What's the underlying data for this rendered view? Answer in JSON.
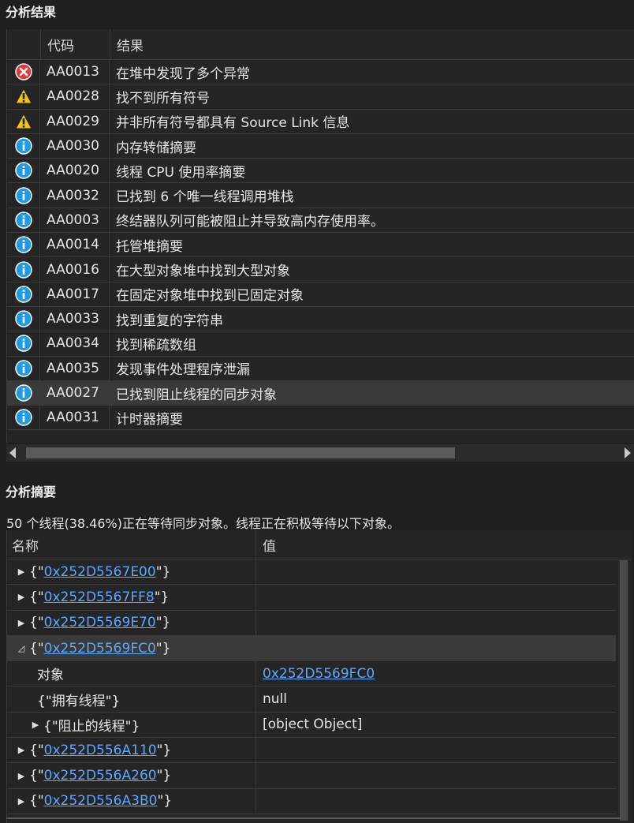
{
  "results_section": {
    "title": "分析结果",
    "headers": {
      "code": "代码",
      "result": "结果"
    },
    "rows": [
      {
        "icon": "error-icon",
        "code": "AA0013",
        "result": "在堆中发现了多个异常"
      },
      {
        "icon": "warning-icon",
        "code": "AA0028",
        "result": "找不到所有符号"
      },
      {
        "icon": "warning-icon",
        "code": "AA0029",
        "result": "并非所有符号都具有 Source Link 信息"
      },
      {
        "icon": "info-icon",
        "code": "AA0030",
        "result": "内存转储摘要"
      },
      {
        "icon": "info-icon",
        "code": "AA0020",
        "result": "线程 CPU 使用率摘要"
      },
      {
        "icon": "info-icon",
        "code": "AA0032",
        "result": "已找到 6 个唯一线程调用堆栈"
      },
      {
        "icon": "info-icon",
        "code": "AA0003",
        "result": "终结器队列可能被阻止并导致高内存使用率。"
      },
      {
        "icon": "info-icon",
        "code": "AA0014",
        "result": "托管堆摘要"
      },
      {
        "icon": "info-icon",
        "code": "AA0016",
        "result": "在大型对象堆中找到大型对象"
      },
      {
        "icon": "info-icon",
        "code": "AA0017",
        "result": "在固定对象堆中找到已固定对象"
      },
      {
        "icon": "info-icon",
        "code": "AA0033",
        "result": "找到重复的字符串"
      },
      {
        "icon": "info-icon",
        "code": "AA0034",
        "result": "找到稀疏数组"
      },
      {
        "icon": "info-icon",
        "code": "AA0035",
        "result": "发现事件处理程序泄漏"
      },
      {
        "icon": "info-icon",
        "code": "AA0027",
        "result": "已找到阻止线程的同步对象",
        "selected": true
      },
      {
        "icon": "info-icon",
        "code": "AA0031",
        "result": "计时器摘要"
      }
    ]
  },
  "summary_section": {
    "title": "分析摘要",
    "description": "50 个线程(38.46%)正在等待同步对象。线程正在积极等待以下对象。",
    "headers": {
      "name": "名称",
      "value": "值"
    },
    "rows": [
      {
        "level": 0,
        "toggle": "▶",
        "prefix": "{\"",
        "link": "0x252D5567E00",
        "suffix": "\"}",
        "value": ""
      },
      {
        "level": 0,
        "toggle": "▶",
        "prefix": "{\"",
        "link": "0x252D5567FF8",
        "suffix": "\"}",
        "value": ""
      },
      {
        "level": 0,
        "toggle": "▶",
        "prefix": "{\"",
        "link": "0x252D5569E70",
        "suffix": "\"}",
        "value": ""
      },
      {
        "level": 0,
        "toggle": "◿",
        "prefix": "{\"",
        "link": "0x252D5569FC0",
        "suffix": "\"}",
        "value": "",
        "expanded": true
      },
      {
        "level": 1,
        "toggle": "",
        "text": "对象",
        "value_link": "0x252D5569FC0"
      },
      {
        "level": 1,
        "toggle": "",
        "text": "{\"拥有线程\"}",
        "value": "null"
      },
      {
        "level": 1,
        "toggle": "▶",
        "text": "{\"阻止的线程\"}",
        "value": "[object Object]"
      },
      {
        "level": 0,
        "toggle": "▶",
        "prefix": "{\"",
        "link": "0x252D556A110",
        "suffix": "\"}",
        "value": ""
      },
      {
        "level": 0,
        "toggle": "▶",
        "prefix": "{\"",
        "link": "0x252D556A260",
        "suffix": "\"}",
        "value": ""
      },
      {
        "level": 0,
        "toggle": "▶",
        "prefix": "{\"",
        "link": "0x252D556A3B0",
        "suffix": "\"}",
        "value": ""
      }
    ]
  },
  "colors": {
    "background": "#1f1f1f",
    "link": "#5aa9ff",
    "error": "#e03a3a",
    "warning": "#f2c40f",
    "info": "#1e9be6"
  }
}
